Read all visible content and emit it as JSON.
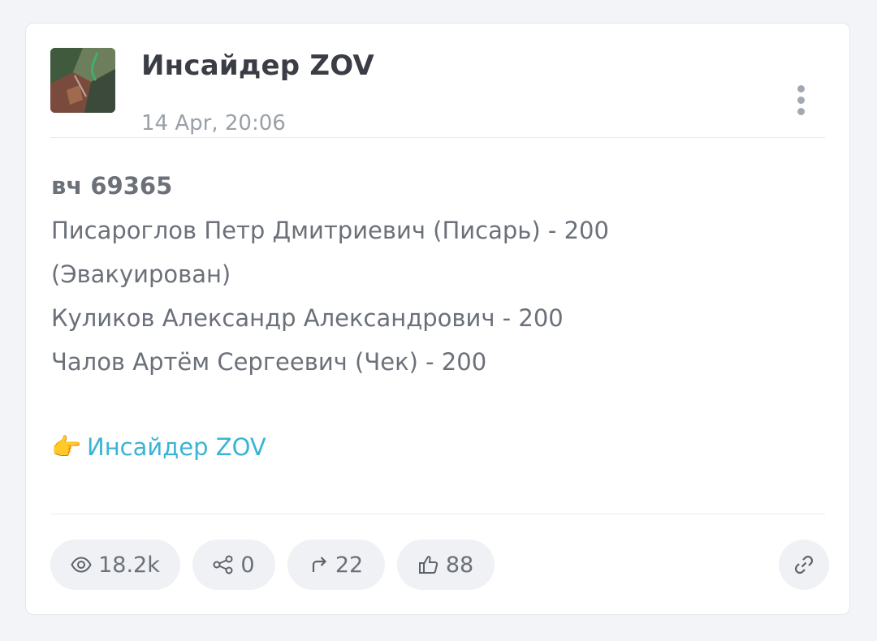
{
  "post": {
    "channel_name": "Инсайдер ZOV",
    "timestamp": "14 Apr, 20:06",
    "menu_icon": "more-vertical-icon",
    "unit": "вч 69365",
    "lines": [
      "Писароглов Петр Дмитриевич (Писарь) - 200",
      "(Эвакуирован)",
      "Куликов Александр Александрович - 200",
      "Чалов Артём Сергеевич (Чек) - 200"
    ],
    "link_emoji": "👉",
    "link_text": "Инсайдер ZOV",
    "colors": {
      "link": "#3ab4d4",
      "text": "#6b7079",
      "title": "#3a3d45",
      "pill_bg": "#eff1f4"
    }
  },
  "stats": {
    "views": "18.2k",
    "shares": "0",
    "forwards": "22",
    "likes": "88"
  }
}
